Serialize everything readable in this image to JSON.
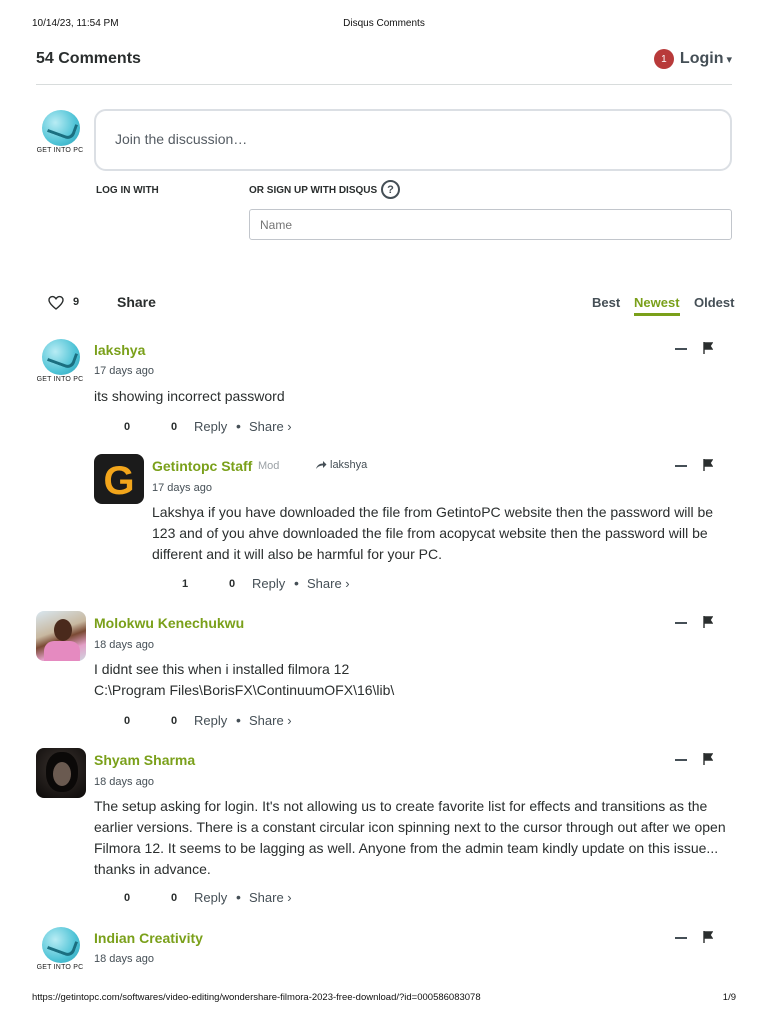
{
  "print_header": {
    "datetime": "10/14/23, 11:54 PM",
    "title": "Disqus Comments"
  },
  "print_footer": {
    "url": "https://getintopc.com/softwares/video-editing/wondershare-filmora-2023-free-download/?id=000586083078",
    "page": "1/9"
  },
  "thread": {
    "comment_count": "54 Comments",
    "notification_count": "1",
    "login_label": "Login",
    "login_caret": "▾"
  },
  "compose": {
    "avatar_logo_text": "GET INTO PC",
    "placeholder": "Join the discussion…",
    "log_in_with": "LOG IN WITH",
    "signup_with_disqus": "OR SIGN UP WITH DISQUS",
    "help_glyph": "?",
    "name_placeholder": "Name"
  },
  "sort_bar": {
    "favorite_count": "9",
    "share_label": "Share",
    "tabs": [
      {
        "label": "Best",
        "active": false
      },
      {
        "label": "Newest",
        "active": true
      },
      {
        "label": "Oldest",
        "active": false
      }
    ]
  },
  "comments": [
    {
      "author": "lakshya",
      "avatar_logo_text": "GET INTO PC",
      "time": "17 days ago",
      "body": [
        "its showing incorrect password"
      ],
      "upvotes": "0",
      "downvotes": "0",
      "reply_label": "Reply",
      "share_label": "Share ›"
    },
    {
      "author": "Getintopc Staff",
      "badge": "Mod",
      "reply_to": "lakshya",
      "avatar_letter": "G",
      "time": "17 days ago",
      "body": [
        "Lakshya if you have downloaded the file from GetintoPC website then the password will be",
        "123 and of you ahve downloaded the file from acopycat website then the password will be",
        "different and it will also be harmful for your PC."
      ],
      "upvotes": "1",
      "downvotes": "0",
      "reply_label": "Reply",
      "share_label": "Share ›"
    },
    {
      "author": "Molokwu Kenechukwu",
      "time": "18 days ago",
      "body": [
        "I didnt see this when i installed filmora 12",
        "C:\\Program Files\\BorisFX\\ContinuumOFX\\16\\lib\\"
      ],
      "upvotes": "0",
      "downvotes": "0",
      "reply_label": "Reply",
      "share_label": "Share ›"
    },
    {
      "author": "Shyam Sharma",
      "time": "18 days ago",
      "body": [
        "The setup asking for login. It's not allowing us to create favorite list for effects and transitions as the",
        "earlier versions. There is a constant circular icon spinning next to the cursor through out after we open",
        "Filmora 12. It seems to be lagging as well. Anyone from the admin team kindly update on this issue...",
        "thanks in advance."
      ],
      "upvotes": "0",
      "downvotes": "0",
      "reply_label": "Reply",
      "share_label": "Share ›"
    },
    {
      "author": "Indian Creativity",
      "avatar_logo_text": "GET INTO PC",
      "time": "18 days ago"
    }
  ],
  "colors": {
    "author_green": "#7aa01a",
    "badge_red": "#b83a3a",
    "text_dark": "#2a2e2e",
    "muted": "#454f56"
  },
  "icons": [
    "heart-outline-icon",
    "question-circle-icon",
    "collapse-minus-icon",
    "flag-icon",
    "reply-arrow-icon"
  ]
}
